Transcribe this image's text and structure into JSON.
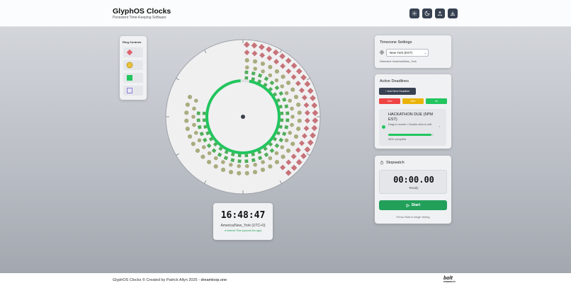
{
  "app": {
    "title": "GlyphOS Clocks",
    "subtitle": "Persistent Time-Keeping Software"
  },
  "header_buttons": [
    {
      "icon": "gear-icon"
    },
    {
      "icon": "moon-icon"
    },
    {
      "icon": "upload-icon"
    },
    {
      "icon": "download-icon"
    }
  ],
  "ring_controls": {
    "title": "Ring Controls",
    "items": [
      {
        "shape": "diamond",
        "color": "#e0636b"
      },
      {
        "shape": "circle",
        "color": "#e9c23a"
      },
      {
        "shape": "square",
        "color": "#22c55e"
      },
      {
        "shape": "square-outline",
        "color": "#8b7fd6"
      }
    ]
  },
  "clock": {
    "time_hours": 16,
    "time_minutes": 48,
    "time_seconds": 47,
    "hour_ring_color": "#c7737a",
    "minute_ring_color": "#a9ac7e",
    "second_ring_color": "#4fae59",
    "progress_ring_color": "#22c55e",
    "progress_fraction": 0.96
  },
  "digital": {
    "time": "16:48:47",
    "timezone": "America/New_York (UTC+0)",
    "sync": "● Internet Time (synced 6m ago)"
  },
  "timezone_settings": {
    "title": "Timezone Settings",
    "selected": "New York (EST)",
    "detected": "Detected: America/New_York"
  },
  "deadlines": {
    "title": "Active Deadlines",
    "add_label": "+ Add New Deadline",
    "quick_buttons": [
      {
        "label": "10m",
        "color": "#ef4444"
      },
      {
        "label": "30m",
        "color": "#eab308"
      },
      {
        "label": "1h",
        "color": "#22c55e"
      }
    ],
    "items": [
      {
        "name": "HACKATHON DUE (5PM EST)",
        "help": "Drag to reorder • Double-click to edit",
        "progress": 0.96,
        "progress_text": "96% complete"
      }
    ]
  },
  "stopwatch": {
    "title": "Stopwatch",
    "time": "00:00.00",
    "state": "Ready",
    "start_label": "Start",
    "hint": "Press Start to begin timing"
  },
  "footer": {
    "text": "GlyphOS Clocks © Created by Patrick Allyn 2025 - ",
    "link": "dreamloop.one",
    "badge_name": "bolt",
    "badge_powered": "POWERED BY"
  }
}
